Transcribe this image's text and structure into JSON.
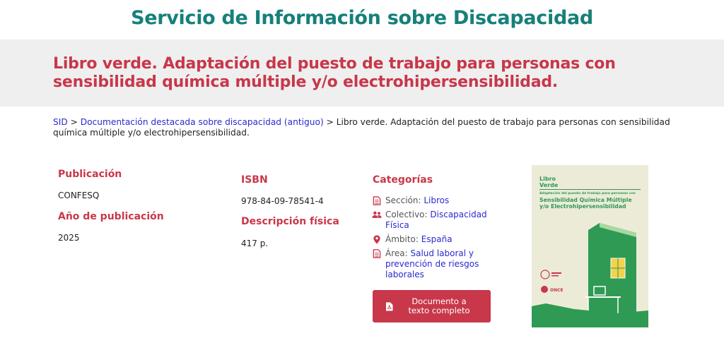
{
  "site": {
    "title": "Servicio de Información sobre Discapacidad"
  },
  "page": {
    "title": "Libro verde. Adaptación del puesto de trabajo para personas con sensibilidad química múltiple y/o electrohipersensibilidad."
  },
  "breadcrumb": {
    "items": [
      "SID",
      "Documentación destacada sobre discapacidad (antiguo)"
    ],
    "separator": ">",
    "current": "Libro verde. Adaptación del puesto de trabajo para personas con sensibilidad química múltiple y/o electrohipersensibilidad."
  },
  "details": {
    "publicacion_label": "Publicación",
    "publicacion_value": "CONFESQ",
    "anio_label": "Año de publicación",
    "anio_value": "2025",
    "isbn_label": "ISBN",
    "isbn_value": "978-84-09-78541-4",
    "descripcion_label": "Descripción física",
    "descripcion_value": "417 p."
  },
  "categorias": {
    "title": "Categorías",
    "items": [
      {
        "label": "Sección:",
        "value": "Libros",
        "icon": "file-icon"
      },
      {
        "label": "Colectivo:",
        "value": "Discapacidad Física",
        "icon": "users-icon"
      },
      {
        "label": "Ámbito:",
        "value": "España",
        "icon": "map-pin-icon"
      },
      {
        "label": "Área:",
        "value": "Salud laboral y prevención de riesgos laborales",
        "icon": "file-icon"
      }
    ]
  },
  "download": {
    "label": "Documento a texto completo",
    "icon": "pdf-file-icon"
  },
  "cover": {
    "title_line1": "Libro",
    "title_line2": "Verde",
    "subtitle": "Adaptación del puesto de trabajo para personas con",
    "heading_line1": "Sensibilidad Química Múltiple",
    "heading_line2": "y/o Electrohipersensibilidad",
    "logo2_text": "ONCE"
  },
  "colors": {
    "accent": "#c8374a",
    "brand": "#16807a",
    "link": "#2a2ad0",
    "banner_bg": "#efefef",
    "cover_bg": "#ecebd8",
    "cover_green": "#2f9a54"
  }
}
